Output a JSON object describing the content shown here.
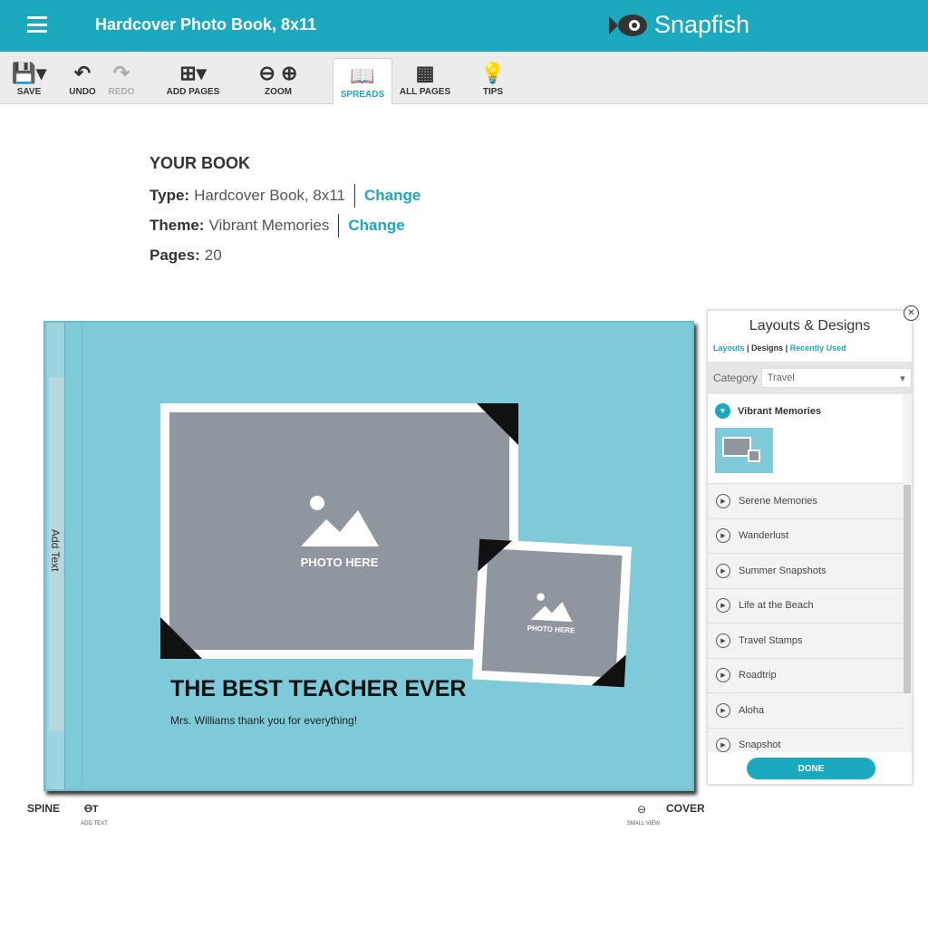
{
  "header": {
    "title": "Hardcover Photo Book, 8x11",
    "brand": "Snapfish",
    "brand_color": "#1aa9bf"
  },
  "toolbar": [
    {
      "label": "SAVE",
      "icon": "save-icon"
    },
    {
      "label": "UNDO",
      "icon": "undo-icon"
    },
    {
      "label": "REDO",
      "icon": "redo-icon",
      "disabled": true
    },
    {
      "label": "ADD PAGES",
      "icon": "add-page-icon"
    },
    {
      "label": "ZOOM",
      "icon": "zoom-icon"
    },
    {
      "label": "SPREADS",
      "icon": "book-icon",
      "active": true
    },
    {
      "label": "ALL PAGES",
      "icon": "grid-icon"
    },
    {
      "label": "TIPS",
      "icon": "lightbulb-icon"
    }
  ],
  "book": {
    "heading": "YOUR BOOK",
    "type_label": "Type:",
    "type": "Hardcover Book, 8x11",
    "theme_label": "Theme:",
    "theme": "Vibrant Memories",
    "pages_label": "Pages:",
    "pages": "20",
    "change": "Change"
  },
  "canvas": {
    "spine_text": "Add Text",
    "photo_placeholder": "PHOTO HERE",
    "title": "THE BEST TEACHER EVER",
    "subtitle": "Mrs. Williams thank you for everything!",
    "bg_color": "#7ecad9"
  },
  "footer": {
    "spine": "SPINE",
    "add_text": "ADD TEXT",
    "small_view": "SMALL VIEW",
    "cover": "COVER"
  },
  "panel": {
    "title": "Layouts & Designs",
    "tabs": [
      "Layouts",
      "Designs",
      "Recently Used"
    ],
    "category_label": "Category",
    "category_value": "Travel",
    "expanded": "Vibrant Memories",
    "items": [
      "Serene Memories",
      "Wanderlust",
      "Summer Snapshots",
      "Life at the Beach",
      "Travel Stamps",
      "Roadtrip",
      "Aloha",
      "Snapshot"
    ],
    "done": "DONE"
  }
}
